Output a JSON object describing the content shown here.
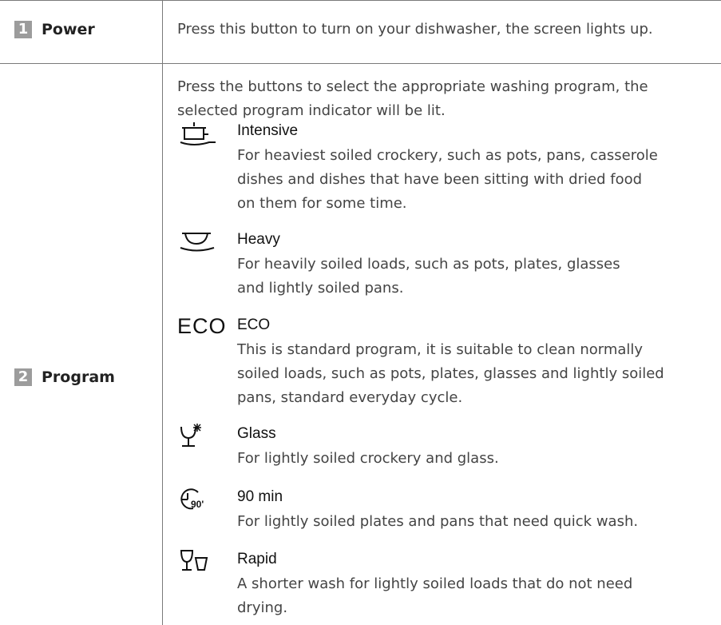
{
  "rows": [
    {
      "number": "1",
      "label": "Power",
      "description": "Press this button to turn on your dishwasher, the screen lights up."
    },
    {
      "number": "2",
      "label": "Program",
      "intro_lines": [
        "Press the buttons to select the appropriate washing program, the",
        "selected program indicator will be lit."
      ],
      "programs": [
        {
          "icon": "pot-icon",
          "title": "Intensive",
          "lines": [
            "For heaviest soiled crockery, such as pots, pans, casserole",
            "dishes and dishes that have been sitting with dried food",
            "on them for some time."
          ]
        },
        {
          "icon": "bowl-icon",
          "title": "Heavy",
          "lines": [
            "For heavily soiled loads, such as pots, plates, glasses",
            "and lightly soiled pans."
          ]
        },
        {
          "icon_text": "ECO",
          "title": "ECO",
          "lines": [
            "This is standard program, it is suitable to clean normally",
            "soiled loads, such as pots, plates, glasses and lightly soiled",
            "pans, standard everyday cycle."
          ]
        },
        {
          "icon": "sparkling-glass-icon",
          "title": "Glass",
          "lines": [
            "For lightly soiled crockery and glass."
          ]
        },
        {
          "icon": "clock-90-icon",
          "icon_text": "90'",
          "title": "90 min",
          "lines": [
            "For lightly soiled plates and pans that need quick wash."
          ]
        },
        {
          "icon": "glass-and-cup-icon",
          "title": "Rapid",
          "lines": [
            "A shorter wash for lightly soiled loads that do not need",
            "drying."
          ]
        }
      ]
    }
  ]
}
